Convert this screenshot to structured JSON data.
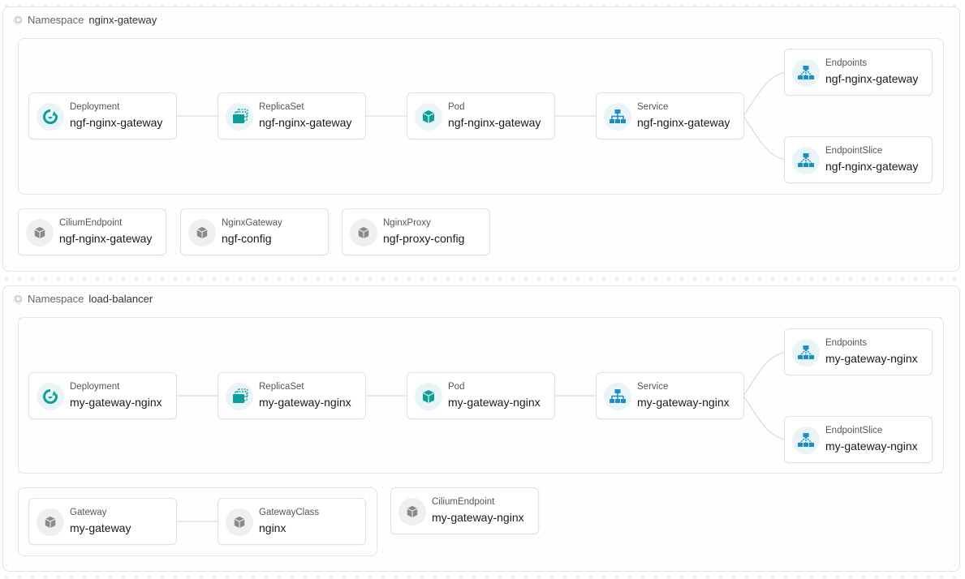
{
  "namespaces": [
    {
      "prefix": "Namespace",
      "name": "nginx-gateway",
      "chain": [
        {
          "kind": "Deployment",
          "name": "ngf-nginx-gateway",
          "icon": "deployment-icon"
        },
        {
          "kind": "ReplicaSet",
          "name": "ngf-nginx-gateway",
          "icon": "replicaset-icon"
        },
        {
          "kind": "Pod",
          "name": "ngf-nginx-gateway",
          "icon": "pod-icon"
        },
        {
          "kind": "Service",
          "name": "ngf-nginx-gateway",
          "icon": "service-icon"
        }
      ],
      "endpoints": {
        "kind": "Endpoints",
        "name": "ngf-nginx-gateway",
        "icon": "endpoints-icon"
      },
      "endpointslice": {
        "kind": "EndpointSlice",
        "name": "ngf-nginx-gateway",
        "icon": "endpointslice-icon"
      },
      "extras": [
        {
          "kind": "CiliumEndpoint",
          "name": "ngf-nginx-gateway",
          "icon": "cube-icon"
        },
        {
          "kind": "NginxGateway",
          "name": "ngf-config",
          "icon": "cube-icon"
        },
        {
          "kind": "NginxProxy",
          "name": "ngf-proxy-config",
          "icon": "cube-icon"
        }
      ]
    },
    {
      "prefix": "Namespace",
      "name": "load-balancer",
      "chain": [
        {
          "kind": "Deployment",
          "name": "my-gateway-nginx",
          "icon": "deployment-icon"
        },
        {
          "kind": "ReplicaSet",
          "name": "my-gateway-nginx",
          "icon": "replicaset-icon"
        },
        {
          "kind": "Pod",
          "name": "my-gateway-nginx",
          "icon": "pod-icon"
        },
        {
          "kind": "Service",
          "name": "my-gateway-nginx",
          "icon": "service-icon"
        }
      ],
      "endpoints": {
        "kind": "Endpoints",
        "name": "my-gateway-nginx",
        "icon": "endpoints-icon"
      },
      "endpointslice": {
        "kind": "EndpointSlice",
        "name": "my-gateway-nginx",
        "icon": "endpointslice-icon"
      },
      "gateway_group": [
        {
          "kind": "Gateway",
          "name": "my-gateway",
          "icon": "cube-icon"
        },
        {
          "kind": "GatewayClass",
          "name": "nginx",
          "icon": "cube-icon"
        }
      ],
      "extras": [
        {
          "kind": "CiliumEndpoint",
          "name": "my-gateway-nginx",
          "icon": "cube-icon"
        }
      ]
    }
  ],
  "colors": {
    "teal": "#0b9e9a",
    "blue": "#1a8fc7",
    "grey": "#8a8a8a"
  }
}
